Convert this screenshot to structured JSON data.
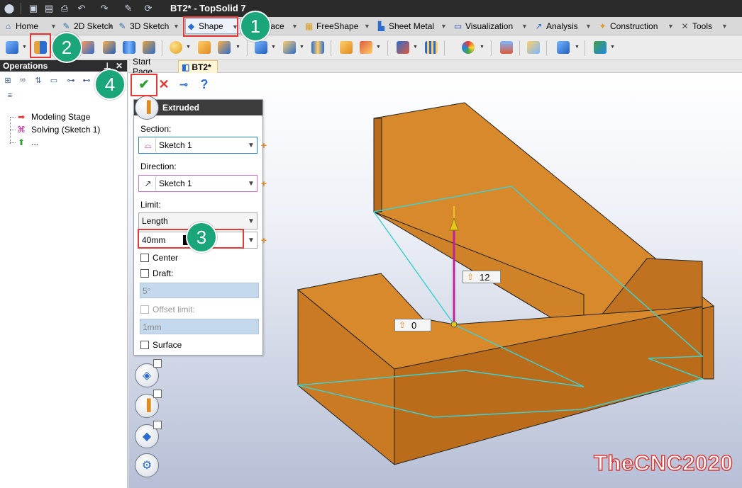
{
  "titlebar": {
    "title": "BT2* - TopSolid 7"
  },
  "ribbon_tabs": [
    {
      "label": "Home",
      "icon": "home-icon"
    },
    {
      "label": "2D Sketch",
      "icon": "pencil-icon"
    },
    {
      "label": "3D Sketch",
      "icon": "pencil-3d-icon"
    },
    {
      "label": "Shape",
      "icon": "cube-icon",
      "active": true
    },
    {
      "label": "face",
      "icon": "surface-icon"
    },
    {
      "label": "FreeShape",
      "icon": "freeshape-icon"
    },
    {
      "label": "Sheet Metal",
      "icon": "sheet-metal-icon"
    },
    {
      "label": "Visualization",
      "icon": "monitor-icon"
    },
    {
      "label": "Analysis",
      "icon": "analysis-icon"
    },
    {
      "label": "Construction",
      "icon": "construction-icon"
    },
    {
      "label": "Tools",
      "icon": "tools-icon"
    }
  ],
  "operations": {
    "title": "Operations",
    "tree": [
      {
        "label": "Modeling Stage",
        "icon": "red-arrow-icon"
      },
      {
        "label": "Solving (Sketch 1)",
        "icon": "paperclip-icon"
      },
      {
        "label": "...",
        "icon": "green-arrow-icon"
      }
    ]
  },
  "doc_tabs": [
    {
      "label": "Start Page"
    },
    {
      "label": "BT2*",
      "active": true
    }
  ],
  "dialog": {
    "title": "Extruded",
    "section_label": "Section:",
    "section_value": "Sketch 1",
    "direction_label": "Direction:",
    "direction_value": "Sketch 1",
    "limit_label": "Limit:",
    "limit_type": "Length",
    "length_value": "40mm",
    "center_label": "Center",
    "draft_label": "Draft:",
    "draft_value": "5°",
    "offset_label": "Offset limit:",
    "offset_value": "1mm",
    "surface_label": "Surface"
  },
  "viewport": {
    "dim_labels": [
      {
        "value": "12"
      },
      {
        "value": "0"
      }
    ]
  },
  "annotations": {
    "badges": [
      "1",
      "2",
      "3",
      "4"
    ]
  },
  "watermark": "TheCNC2020",
  "colors": {
    "model_fill": "#c87a20",
    "sketch_outline": "#3fd0d0",
    "direction_vector": "#c0209a",
    "badge": "#1aa67a",
    "highlight_box": "#e53935"
  }
}
